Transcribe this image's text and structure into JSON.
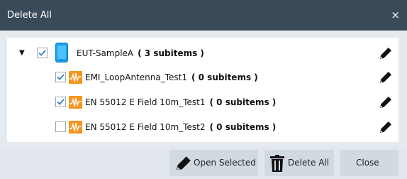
{
  "dialog": {
    "title": "Delete All",
    "close_glyph": "×"
  },
  "tree": {
    "root": {
      "expander": "▼",
      "checked": true,
      "icon": "device-icon",
      "name": "EUT-SampleA",
      "count": "( 3   subitems )"
    },
    "items": [
      {
        "name": "EMI_LoopAntenna_Test1",
        "count": "( 0   subitems )",
        "checked": true,
        "icon": "waveform-icon"
      },
      {
        "name": "EN 55012 E Field 10m_Test1",
        "count": "( 0   subitems )",
        "checked": true,
        "icon": "waveform-icon"
      },
      {
        "name": "EN 55012 E Field 10m_Test2",
        "count": "( 0   subitems )",
        "checked": false,
        "icon": "waveform-icon"
      }
    ],
    "edit_icon": "pencil-icon"
  },
  "footer": {
    "open_selected": "Open Selected",
    "delete_all": "Delete All",
    "close": "Close"
  },
  "colors": {
    "titlebar": "#3a4a58",
    "accent_orange": "#f7941d",
    "accent_blue": "#1aa0e8",
    "check_blue": "#2a7fd4"
  }
}
